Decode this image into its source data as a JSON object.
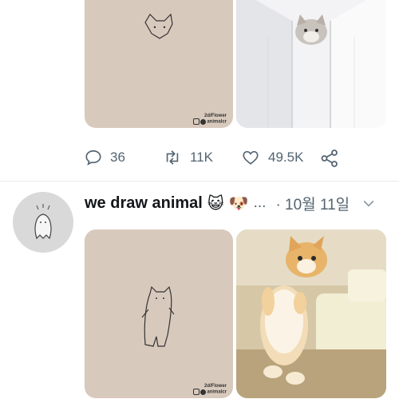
{
  "tweet1": {
    "image_left_credit_line1": "2d/Flower",
    "image_left_credit_line2": "animalcr",
    "replies": "36",
    "retweets": "11K",
    "likes": "49.5K"
  },
  "tweet2": {
    "author_name": "we draw animal",
    "emoji1": "😺",
    "emoji2": "🐶",
    "ellipsis": "...",
    "date": "· 10월 11일",
    "image_left_credit_line1": "2d/Flower",
    "image_left_credit_line2": "animalcr"
  },
  "icons": [
    "reply-icon",
    "retweet-icon",
    "like-icon",
    "share-icon",
    "chevron-down-icon"
  ]
}
